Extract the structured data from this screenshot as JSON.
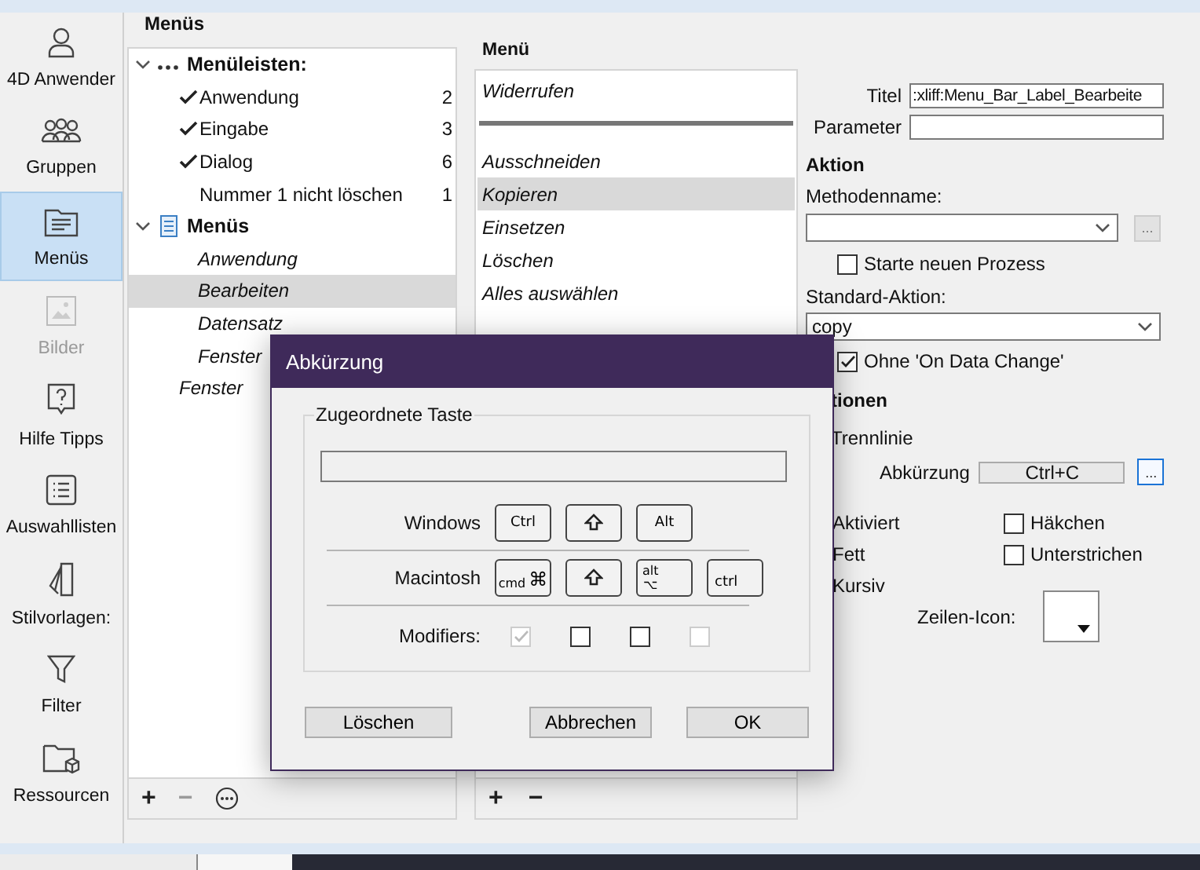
{
  "sidebar": {
    "items": [
      {
        "kind": "user",
        "label": "4D Anwender",
        "selected": false,
        "disabled": false
      },
      {
        "kind": "group",
        "label": "Gruppen",
        "selected": false,
        "disabled": false
      },
      {
        "kind": "menus",
        "label": "Menüs",
        "selected": true,
        "disabled": false
      },
      {
        "kind": "picture",
        "label": "Bilder",
        "selected": false,
        "disabled": true
      },
      {
        "kind": "help",
        "label": "Hilfe Tipps",
        "selected": false,
        "disabled": false
      },
      {
        "kind": "list",
        "label": "Auswahllisten",
        "selected": false,
        "disabled": false
      },
      {
        "kind": "styles",
        "label": "Stilvorlagen:",
        "selected": false,
        "disabled": false
      },
      {
        "kind": "filter",
        "label": "Filter",
        "selected": false,
        "disabled": false
      },
      {
        "kind": "resources",
        "label": "Ressourcen",
        "selected": false,
        "disabled": false
      }
    ]
  },
  "tree": {
    "title": "Menüs",
    "items": [
      {
        "kind": "bars",
        "label": "Menüleisten:",
        "expanded": true,
        "children": [
          {
            "kind": "bar",
            "label": "Anwendung",
            "checked": true,
            "count": "2",
            "selected": false
          },
          {
            "kind": "bar",
            "label": "Eingabe",
            "checked": true,
            "count": "3",
            "selected": false
          },
          {
            "kind": "bar",
            "label": "Dialog",
            "checked": true,
            "count": "6",
            "selected": false
          },
          {
            "kind": "bar",
            "label": "Nummer 1 nicht löschen",
            "checked": false,
            "count": "1",
            "selected": false
          }
        ]
      },
      {
        "kind": "menus",
        "label": "Menüs",
        "expanded": true,
        "children": [
          {
            "kind": "menu",
            "label": "Anwendung",
            "selected": false
          },
          {
            "kind": "menu",
            "label": "Bearbeiten",
            "selected": true
          },
          {
            "kind": "menu",
            "label": "Datensatz",
            "selected": false
          },
          {
            "kind": "menu",
            "label": "Fenster",
            "selected": false
          }
        ]
      },
      {
        "kind": "menu",
        "label": "Fenster",
        "selected": false
      }
    ],
    "toolbar": [
      {
        "kind": "text",
        "label": "+",
        "disabled": false
      },
      {
        "kind": "text",
        "label": "−",
        "disabled": true
      },
      {
        "kind": "more",
        "disabled": false
      }
    ]
  },
  "menu": {
    "title": "Menü",
    "items": [
      {
        "kind": "item",
        "label": "Widerrufen",
        "selected": false
      },
      {
        "kind": "separator"
      },
      {
        "kind": "item",
        "label": "Ausschneiden",
        "selected": false
      },
      {
        "kind": "item",
        "label": "Kopieren",
        "selected": true
      },
      {
        "kind": "item",
        "label": "Einsetzen",
        "selected": false
      },
      {
        "kind": "item",
        "label": "Löschen",
        "selected": false
      },
      {
        "kind": "item",
        "label": "Alles auswählen",
        "selected": false
      }
    ],
    "toolbar": [
      {
        "kind": "text",
        "label": "+",
        "disabled": false
      },
      {
        "kind": "text",
        "label": "−",
        "disabled": false
      }
    ]
  },
  "properties": {
    "title_label": "Titel",
    "title_value": ":xliff:Menu_Bar_Label_Bearbeite",
    "parameter_label": "Parameter",
    "action_heading": "Aktion",
    "method_label": "Methodenname:",
    "method_button": "...",
    "new_process": {
      "label": "Starte neuen Prozess",
      "checked": false
    },
    "standard_action_label": "Standard-Aktion:",
    "standard_action_value": "copy",
    "no_data_change": {
      "label": "Ohne 'On Data Change'",
      "checked": true
    },
    "options_heading": "tionen",
    "separator_label": "Trennlinie",
    "shortcut_label": "Abkürzung",
    "shortcut_value": "Ctrl+C",
    "shortcut_button": "...",
    "style_labels": [
      "Aktiviert",
      "Fett",
      "Kursiv"
    ],
    "style_checks": [
      {
        "label": "Häkchen",
        "checked": false
      },
      {
        "label": "Unterstrichen",
        "checked": false
      }
    ],
    "line_icon_label": "Zeilen-Icon:"
  },
  "dialog": {
    "title": "Abkürzung",
    "group_label": "Zugeordnete Taste",
    "rows": [
      {
        "label": "Windows",
        "keys": [
          {
            "kind": "text",
            "label": "Ctrl"
          },
          {
            "kind": "shift"
          },
          {
            "kind": "text",
            "label": "Alt"
          }
        ]
      },
      {
        "label": "Macintosh",
        "keys": [
          {
            "kind": "cmd",
            "label": "cmd",
            "symbol": "⌘"
          },
          {
            "kind": "shift"
          },
          {
            "kind": "alt",
            "label": "alt",
            "symbol": "⌥"
          },
          {
            "kind": "corner",
            "label": "ctrl"
          }
        ]
      }
    ],
    "modifiers": {
      "label": "Modifiers:",
      "boxes": [
        {
          "checked": true,
          "disabled": true
        },
        {
          "checked": false,
          "disabled": false
        },
        {
          "checked": false,
          "disabled": false
        },
        {
          "checked": false,
          "disabled": true
        }
      ]
    },
    "buttons": [
      {
        "label": "Löschen"
      },
      {
        "label": "Abbrechen"
      },
      {
        "label": "OK"
      }
    ]
  }
}
